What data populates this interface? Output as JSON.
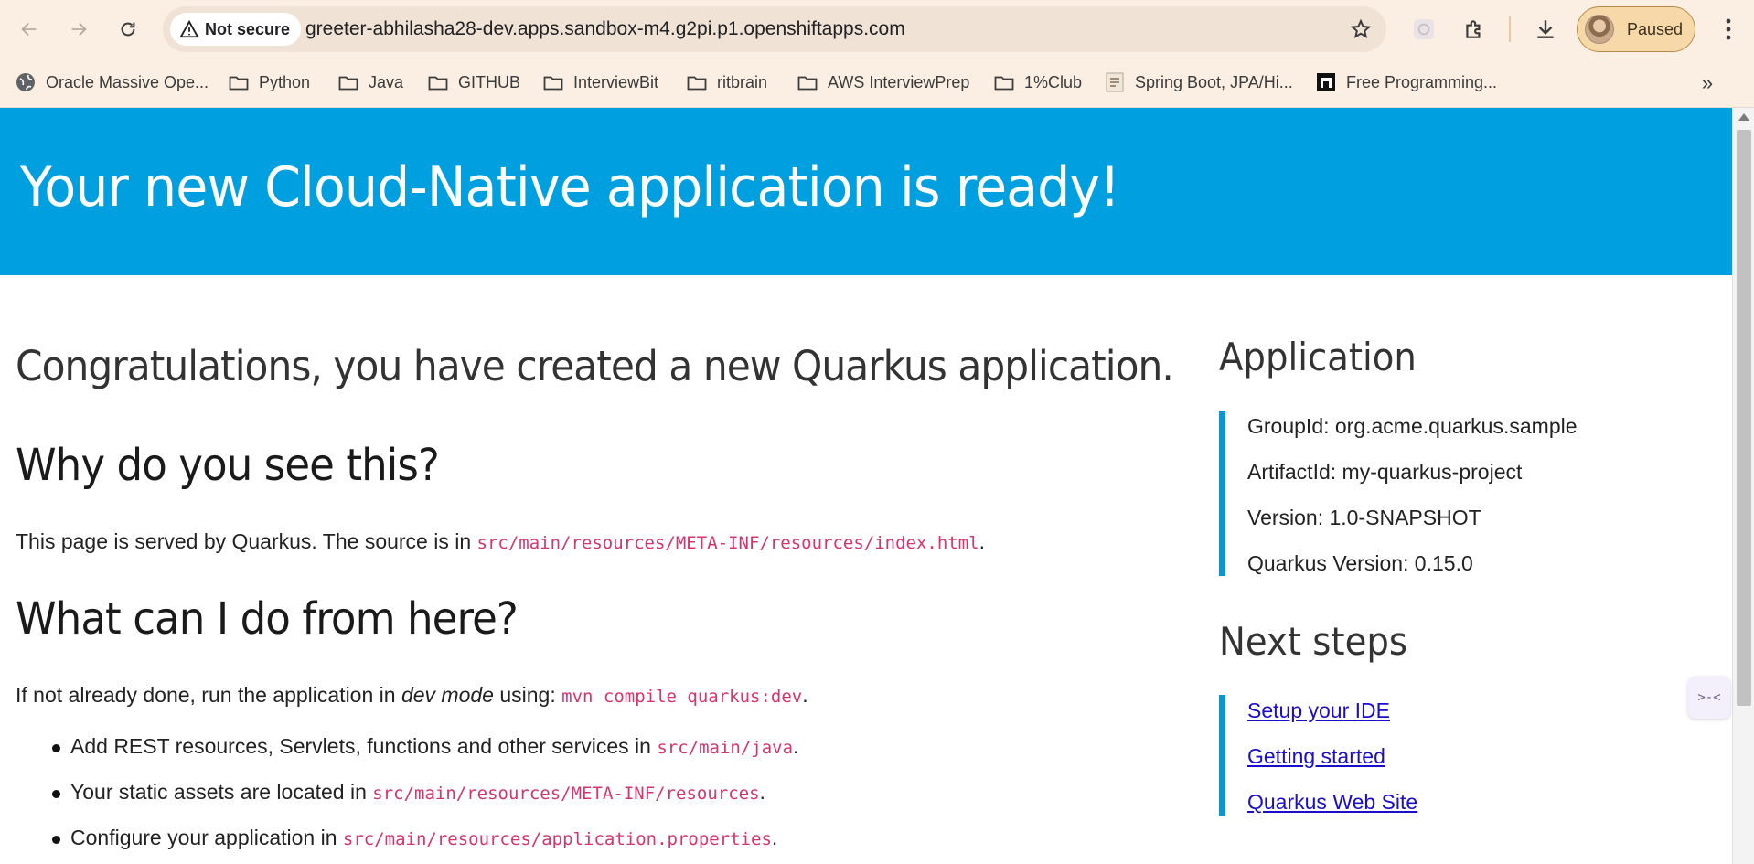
{
  "browser": {
    "security_label": "Not secure",
    "url": "greeter-abhilasha28-dev.apps.sandbox-m4.g2pi.p1.openshiftapps.com",
    "profile_status": "Paused",
    "bookmarks": [
      {
        "label": "Oracle Massive Ope...",
        "icon": "globe-icon"
      },
      {
        "label": "Python",
        "icon": "folder-icon"
      },
      {
        "label": "Java",
        "icon": "folder-icon"
      },
      {
        "label": "GITHUB",
        "icon": "folder-icon"
      },
      {
        "label": "InterviewBit",
        "icon": "folder-icon"
      },
      {
        "label": "ritbrain",
        "icon": "folder-icon"
      },
      {
        "label": "AWS InterviewPrep",
        "icon": "folder-icon"
      },
      {
        "label": "1%Club",
        "icon": "folder-icon"
      },
      {
        "label": "Spring Boot, JPA/Hi...",
        "icon": "site-favicon-icon"
      },
      {
        "label": "Free Programming...",
        "icon": "site-favicon-icon"
      }
    ],
    "bookmarks_overflow": "»"
  },
  "page": {
    "banner_title": "Your new Cloud-Native application is ready!",
    "lead": "Congratulations, you have created a new Quarkus application.",
    "why_heading": "Why do you see this?",
    "why_text_prefix": "This page is served by Quarkus. The source is in ",
    "why_code": "src/main/resources/META-INF/resources/index.html",
    "why_text_suffix": ".",
    "what_heading": "What can I do from here?",
    "what_prefix": "If not already done, run the application in ",
    "what_em": "dev mode",
    "what_mid": " using: ",
    "what_code": "mvn compile quarkus:dev",
    "what_suffix": ".",
    "bullets": [
      {
        "text": "Add REST resources, Servlets, functions and other services in ",
        "code": "src/main/java",
        "suffix": "."
      },
      {
        "text": "Your static assets are located in ",
        "code": "src/main/resources/META-INF/resources",
        "suffix": "."
      },
      {
        "text": "Configure your application in ",
        "code": "src/main/resources/application.properties",
        "suffix": "."
      }
    ]
  },
  "sidebar": {
    "application_heading": "Application",
    "application_items": [
      "GroupId: org.acme.quarkus.sample",
      "ArtifactId: my-quarkus-project",
      "Version: 1.0-SNAPSHOT",
      "Quarkus Version: 0.15.0"
    ],
    "next_heading": "Next steps",
    "next_links": [
      "Setup your IDE",
      "Getting started",
      "Quarkus Web Site"
    ]
  },
  "colors": {
    "banner": "#009fe0",
    "code": "#d6346c",
    "link": "#1a0dcc",
    "sidebar_accent": "#0796d8",
    "chrome_bg": "#fbefe3"
  }
}
